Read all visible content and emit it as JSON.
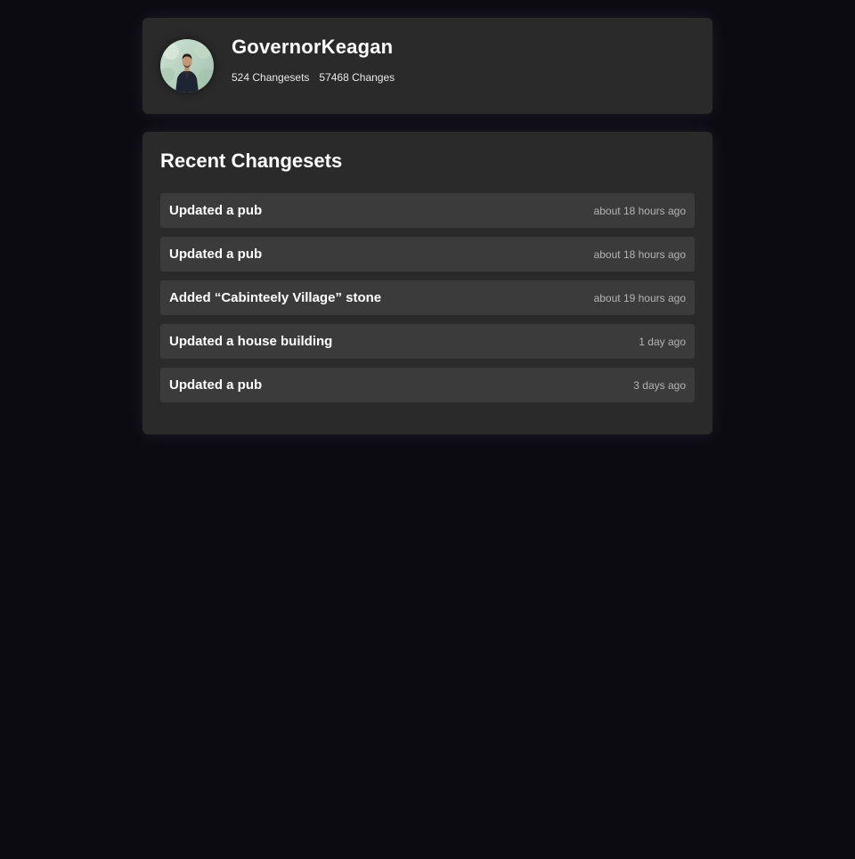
{
  "profile": {
    "username": "GovernorKeagan",
    "changesets": "524 Changesets",
    "changes": "57468 Changes",
    "avatar_icon": "user-avatar-photo"
  },
  "recent": {
    "title": "Recent Changesets",
    "items": [
      {
        "title": "Updated a pub",
        "time": "about 18 hours ago"
      },
      {
        "title": "Updated a pub",
        "time": "about 18 hours ago"
      },
      {
        "title": "Added “Cabinteely Village” stone",
        "time": "about 19 hours ago"
      },
      {
        "title": "Updated a house building",
        "time": "1 day ago"
      },
      {
        "title": "Updated a pub",
        "time": "3 days ago"
      }
    ]
  },
  "colors": {
    "background": "#0d0b12",
    "card": "#2a2a2a",
    "row": "#3b3b3b",
    "muted_text": "#b4b4b4"
  }
}
